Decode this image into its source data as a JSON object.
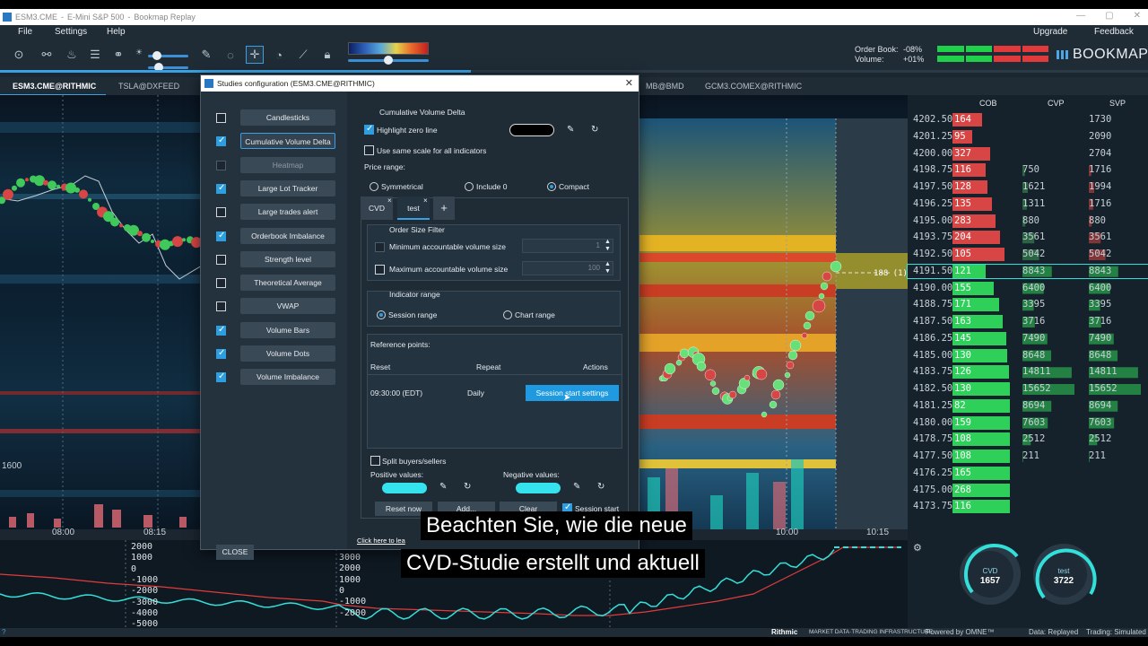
{
  "window": {
    "title_parts": [
      "ESM3.CME",
      "E-Mini S&P 500",
      "Bookmap Replay"
    ],
    "controls": [
      "—",
      "▢",
      "✕"
    ]
  },
  "menu": {
    "file": "File",
    "settings": "Settings",
    "help": "Help",
    "upgrade": "Upgrade",
    "feedback": "Feedback"
  },
  "toolbar": {
    "icons": [
      "crosshair-settings-icon",
      "share-icon",
      "paint-icon",
      "layers-icon",
      "link-icon",
      "brightness-icon",
      "pencil-icon",
      "chat-icon",
      "crosshair-icon",
      "timer-icon",
      "chart-icon",
      "lock-icon"
    ]
  },
  "orderbook": {
    "order_book_label": "Order Book:",
    "order_book_value": "-08%",
    "volume_label": "Volume:",
    "volume_value": "+01%",
    "order_book_fraction": 0.46,
    "volume_fraction": 0.505,
    "buy_color": "#1fd04a",
    "sell_color": "#e23a3a"
  },
  "logo": {
    "text": "BOOKMAP"
  },
  "replay_progress": 0.41,
  "tabs": [
    "ESM3.CME@RITHMIC",
    "TSLA@DXFEED",
    "MB@BMD",
    "GCM3.COMEX@RITHMIC"
  ],
  "chart": {
    "time_labels": [
      "08:00",
      "08:15",
      "10:00",
      "10:15"
    ],
    "left_price_label": "1600",
    "current_price_tag": "188 (1)"
  },
  "ladder": {
    "headers": {
      "cob": "COB",
      "cvp": "CVP",
      "svp": "SVP"
    },
    "rows": [
      {
        "price": "4202.50",
        "cob": "164",
        "cvp": "",
        "svp": "1730",
        "side": "ask",
        "bar": 0.48
      },
      {
        "price": "4201.25",
        "cob": "95",
        "cvp": "",
        "svp": "2090",
        "side": "ask",
        "bar": 0.32
      },
      {
        "price": "4200.00",
        "cob": "327",
        "cvp": "",
        "svp": "2704",
        "side": "ask",
        "bar": 0.62
      },
      {
        "price": "4198.75",
        "cob": "116",
        "cvp": "750",
        "svp": "1716",
        "side": "ask",
        "bar": 0.55
      },
      {
        "price": "4197.50",
        "cob": "128",
        "cvp": "1621",
        "svp": "1994",
        "side": "ask",
        "bar": 0.58
      },
      {
        "price": "4196.25",
        "cob": "135",
        "cvp": "1311",
        "svp": "1716",
        "side": "ask",
        "bar": 0.64
      },
      {
        "price": "4195.00",
        "cob": "283",
        "cvp": "880",
        "svp": "880",
        "side": "ask",
        "bar": 0.7
      },
      {
        "price": "4193.75",
        "cob": "204",
        "cvp": "3561",
        "svp": "3561",
        "side": "ask",
        "bar": 0.78
      },
      {
        "price": "4192.50",
        "cob": "105",
        "cvp": "5042",
        "svp": "5042",
        "side": "ask",
        "bar": 0.86
      },
      {
        "price": "4191.50",
        "cob": "121",
        "cvp": "8843",
        "svp": "8843",
        "side": "bid",
        "bar": 0.55
      },
      {
        "price": "4190.00",
        "cob": "155",
        "cvp": "6400",
        "svp": "6400",
        "side": "bid",
        "bar": 0.68
      },
      {
        "price": "4188.75",
        "cob": "171",
        "cvp": "3395",
        "svp": "3395",
        "side": "bid",
        "bar": 0.76
      },
      {
        "price": "4187.50",
        "cob": "163",
        "cvp": "3716",
        "svp": "3716",
        "side": "bid",
        "bar": 0.82
      },
      {
        "price": "4186.25",
        "cob": "145",
        "cvp": "7490",
        "svp": "7490",
        "side": "bid",
        "bar": 0.88
      },
      {
        "price": "4185.00",
        "cob": "130",
        "cvp": "8648",
        "svp": "8648",
        "side": "bid",
        "bar": 0.9
      },
      {
        "price": "4183.75",
        "cob": "126",
        "cvp": "14811",
        "svp": "14811",
        "side": "bid",
        "bar": 0.92
      },
      {
        "price": "4182.50",
        "cob": "130",
        "cvp": "15652",
        "svp": "15652",
        "side": "bid",
        "bar": 0.94
      },
      {
        "price": "4181.25",
        "cob": "82",
        "cvp": "8694",
        "svp": "8694",
        "side": "bid",
        "bar": 0.94
      },
      {
        "price": "4180.00",
        "cob": "159",
        "cvp": "7603",
        "svp": "7603",
        "side": "bid",
        "bar": 0.94
      },
      {
        "price": "4178.75",
        "cob": "108",
        "cvp": "2512",
        "svp": "2512",
        "side": "bid",
        "bar": 0.94
      },
      {
        "price": "4177.50",
        "cob": "108",
        "cvp": "211",
        "svp": "211",
        "side": "bid",
        "bar": 0.94
      },
      {
        "price": "4176.25",
        "cob": "165",
        "cvp": "",
        "svp": "",
        "side": "bid",
        "bar": 0.94
      },
      {
        "price": "4175.00",
        "cob": "268",
        "cvp": "",
        "svp": "",
        "side": "bid",
        "bar": 0.94
      },
      {
        "price": "4173.75",
        "cob": "116",
        "cvp": "",
        "svp": "",
        "side": "bid",
        "bar": 0.94
      }
    ],
    "highlight_price": "4191.50"
  },
  "indicator": {
    "left_axis": [
      "2000",
      "1000",
      "0",
      "-1000",
      "-2000",
      "-3000",
      "-4000",
      "-5000"
    ],
    "mid_axis": [
      "3000",
      "2000",
      "1000",
      "0",
      "-1000",
      "-2000"
    ],
    "line_color": "#33e0d9"
  },
  "gauges": [
    {
      "label": "CVD",
      "value": "1657"
    },
    {
      "label": "test",
      "value": "3722"
    }
  ],
  "status": {
    "rithmic": "Rithmic",
    "rithmic_tag": "MARKET DATA·TRADING INFRASTRUCTURE",
    "omne": "Powered by OMNE™",
    "data": "Data: Replayed",
    "trading": "Trading: Simulated"
  },
  "dialog": {
    "title": "Studies configuration (ESM3.CME@RITHMIC)",
    "close_label": "CLOSE",
    "studies": [
      {
        "label": "Candlesticks",
        "checked": false,
        "enabled": true
      },
      {
        "label": "Cumulative Volume Delta",
        "checked": true,
        "enabled": true,
        "selected": true
      },
      {
        "label": "Heatmap",
        "checked": false,
        "enabled": false
      },
      {
        "label": "Large Lot Tracker",
        "checked": true,
        "enabled": true
      },
      {
        "label": "Large trades alert",
        "checked": false,
        "enabled": true
      },
      {
        "label": "Orderbook Imbalance",
        "checked": true,
        "enabled": true
      },
      {
        "label": "Strength level",
        "checked": false,
        "enabled": true
      },
      {
        "label": "Theoretical Average",
        "checked": false,
        "enabled": true
      },
      {
        "label": "VWAP",
        "checked": false,
        "enabled": true
      },
      {
        "label": "Volume Bars",
        "checked": true,
        "enabled": true
      },
      {
        "label": "Volume Dots",
        "checked": true,
        "enabled": true
      },
      {
        "label": "Volume Imbalance",
        "checked": true,
        "enabled": true
      }
    ],
    "section_title": "Cumulative Volume Delta",
    "highlight_zero": "Highlight zero line",
    "same_scale": "Use same scale for all indicators",
    "price_range": "Price range:",
    "pr_options": [
      "Symmetrical",
      "Include 0",
      "Compact"
    ],
    "subtabs": [
      "CVD",
      "test"
    ],
    "order_filter_title": "Order Size Filter",
    "min_volume": "Minimum accountable volume size",
    "min_value": "1",
    "max_volume": "Maximum accountable volume size",
    "max_value": "100",
    "indicator_range_title": "Indicator range",
    "session_range": "Session range",
    "chart_range": "Chart range",
    "ref_points": "Reference points:",
    "col_reset": "Reset",
    "col_repeat": "Repeat",
    "col_actions": "Actions",
    "ref_time": "09:30:00 (EDT)",
    "ref_repeat": "Daily",
    "session_settings": "Session start settings",
    "split": "Split buyers/sellers",
    "positive": "Positive values:",
    "negative": "Negative values:",
    "pill_color": "#35e3ef",
    "reset_now": "Reset now",
    "add": "Add...",
    "clear": "Clear",
    "session_start": "Session start",
    "click_here": "Click here to lea"
  },
  "subtitle": {
    "line1": "Beachten Sie, wie die neue",
    "line2": "CVD-Studie erstellt und aktuell"
  }
}
